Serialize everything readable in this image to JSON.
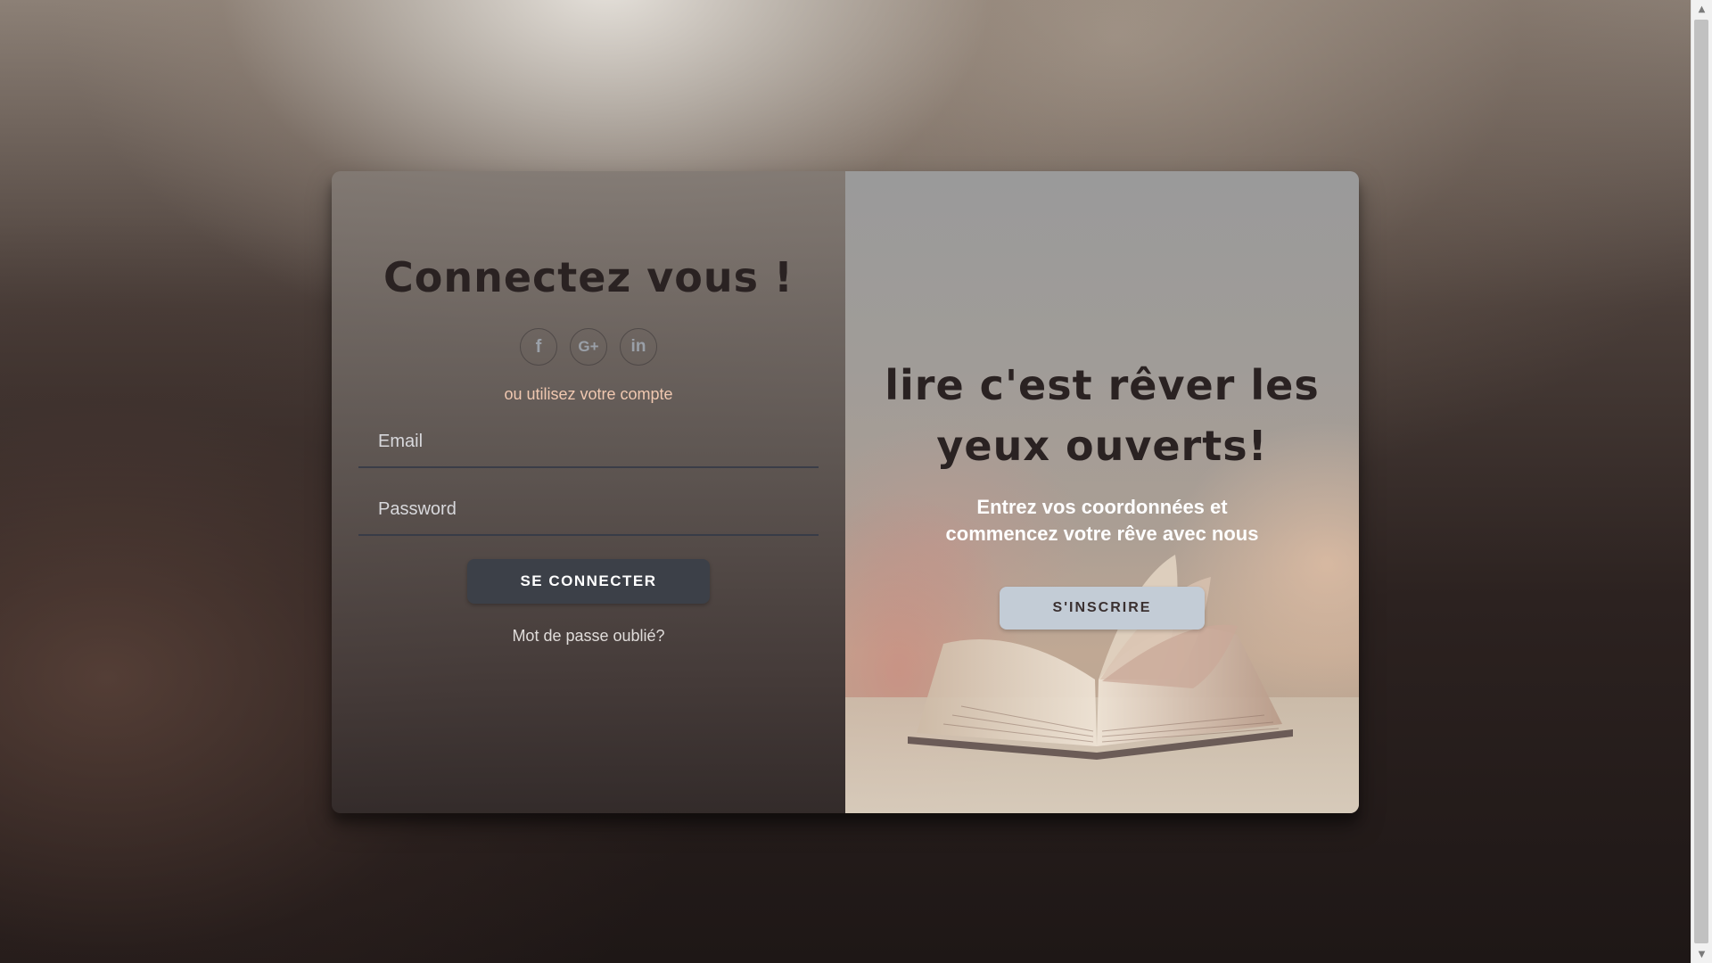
{
  "login": {
    "title": "Connectez vous !",
    "social": [
      {
        "name": "facebook",
        "glyph": "f"
      },
      {
        "name": "google-plus",
        "glyph": "G+"
      },
      {
        "name": "linkedin",
        "glyph": "in"
      }
    ],
    "alt_text": "ou utilisez votre compte",
    "email_placeholder": "Email",
    "password_placeholder": "Password",
    "submit_label": "SE CONNECTER",
    "forgot_label": "Mot de passe oublié?"
  },
  "overlay": {
    "title_line1": "lire c'est rêver les",
    "title_line2": "yeux ouverts!",
    "subtitle_line1": "Entrez vos coordonnées et",
    "subtitle_line2": "commencez votre rêve avec nous",
    "signup_label": "S'INSCRIRE"
  },
  "icons": {
    "facebook": "facebook-icon",
    "google_plus": "google-plus-icon",
    "linkedin": "linkedin-icon",
    "book": "open-book-image",
    "scroll_up": "scroll-up-arrow-icon",
    "scroll_down": "scroll-down-arrow-icon"
  },
  "colors": {
    "login_button": "#3c4048",
    "signup_button": "#c3ccd6",
    "alt_text": "#f0c8b0",
    "title": "#2a2222"
  }
}
